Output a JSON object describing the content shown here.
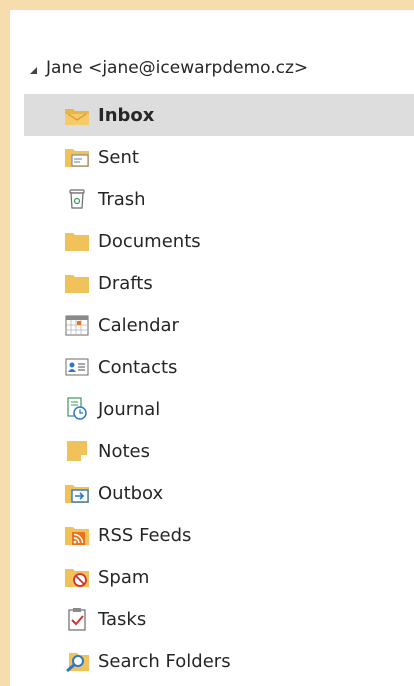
{
  "account": {
    "label": "Jane <jane@icewarpdemo.cz>"
  },
  "folders": [
    {
      "label": "Inbox",
      "icon": "inbox-icon",
      "selected": true
    },
    {
      "label": "Sent",
      "icon": "sent-folder-icon"
    },
    {
      "label": "Trash",
      "icon": "trash-icon"
    },
    {
      "label": "Documents",
      "icon": "folder-icon"
    },
    {
      "label": "Drafts",
      "icon": "folder-icon"
    },
    {
      "label": "Calendar",
      "icon": "calendar-icon"
    },
    {
      "label": "Contacts",
      "icon": "contacts-icon"
    },
    {
      "label": "Journal",
      "icon": "journal-icon"
    },
    {
      "label": "Notes",
      "icon": "notes-icon"
    },
    {
      "label": "Outbox",
      "icon": "outbox-icon"
    },
    {
      "label": "RSS Feeds",
      "icon": "rss-icon"
    },
    {
      "label": "Spam",
      "icon": "spam-icon"
    },
    {
      "label": "Tasks",
      "icon": "tasks-icon"
    },
    {
      "label": "Search Folders",
      "icon": "search-folder-icon"
    }
  ],
  "colors": {
    "frame_border": "#f7dcae",
    "selected_bg": "#dddddd",
    "folder_yellow": "#f2c25a",
    "accent_blue": "#2a78c8",
    "rss_orange": "#e8731a",
    "spam_red": "#d3302f"
  }
}
